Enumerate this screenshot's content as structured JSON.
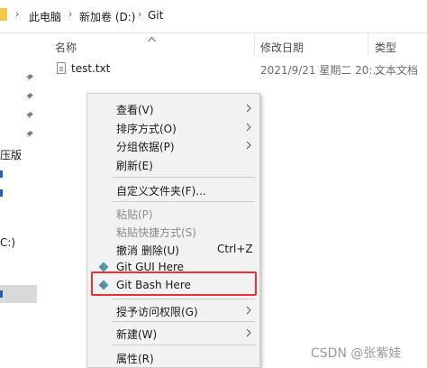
{
  "breadcrumb": {
    "items": [
      "此电脑",
      "新加卷 (D:)",
      "Git"
    ]
  },
  "nav": {
    "labels": [
      "压版",
      "C:)"
    ]
  },
  "columns": {
    "name": "名称",
    "modified": "修改日期",
    "type": "类型"
  },
  "file": {
    "name": "test.txt",
    "modified": "2021/9/21 星期二 20:...",
    "type": "文本文档"
  },
  "context_menu": {
    "view": "查看(V)",
    "sort": "排序方式(O)",
    "group": "分组依据(P)",
    "refresh": "刷新(E)",
    "customize": "自定义文件夹(F)...",
    "paste": "粘贴(P)",
    "paste_shortcut": "粘贴快捷方式(S)",
    "undo": "撤消 删除(U)",
    "undo_shortcut": "Ctrl+Z",
    "git_gui": "Git GUI Here",
    "git_bash": "Git Bash Here",
    "give_access": "授予访问权限(G)",
    "new": "新建(W)",
    "properties": "属性(R)"
  },
  "watermark": "CSDN @张紫娃",
  "colors": {
    "highlight_border": "#e8313a",
    "git_orange": "#f0502f",
    "git_blue": "#3f8ed8",
    "git_green": "#4cb944"
  }
}
